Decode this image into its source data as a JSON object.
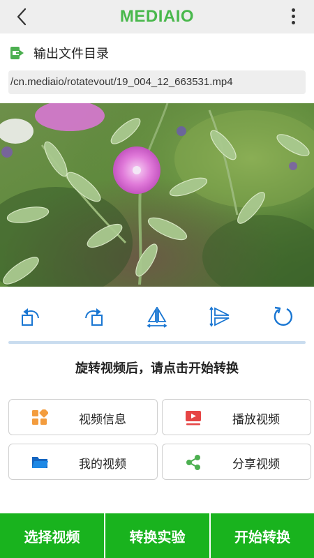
{
  "header": {
    "title": "MEDIAIO",
    "back_icon": "back-chevron-icon",
    "menu_icon": "more-vertical-icon",
    "title_color": "#49b84c"
  },
  "output": {
    "label": "输出文件目录",
    "icon": "export-folder-icon",
    "path": "/cn.mediaio/rotatevout/19_004_12_663531.mp4"
  },
  "preview": {
    "description_icon": "video-preview"
  },
  "tools": {
    "items": [
      {
        "name": "rotate-left-icon"
      },
      {
        "name": "rotate-right-icon"
      },
      {
        "name": "flip-horizontal-icon"
      },
      {
        "name": "flip-vertical-icon"
      },
      {
        "name": "reset-rotate-icon"
      }
    ],
    "accent": "#1976d2"
  },
  "hint": "旋转视频后，请点击开始转换",
  "cards": [
    {
      "label": "视频信息",
      "icon": "grid-icon",
      "color": "#f39c3d"
    },
    {
      "label": "播放视频",
      "icon": "play-video-icon",
      "color": "#e64545"
    },
    {
      "label": "我的视频",
      "icon": "folder-icon",
      "color": "#1976d2"
    },
    {
      "label": "分享视频",
      "icon": "share-icon",
      "color": "#4caf50"
    }
  ],
  "bottom": {
    "select_label": "选择视频",
    "lab_label": "转换实验",
    "start_label": "开始转换",
    "color": "#19b31e"
  }
}
